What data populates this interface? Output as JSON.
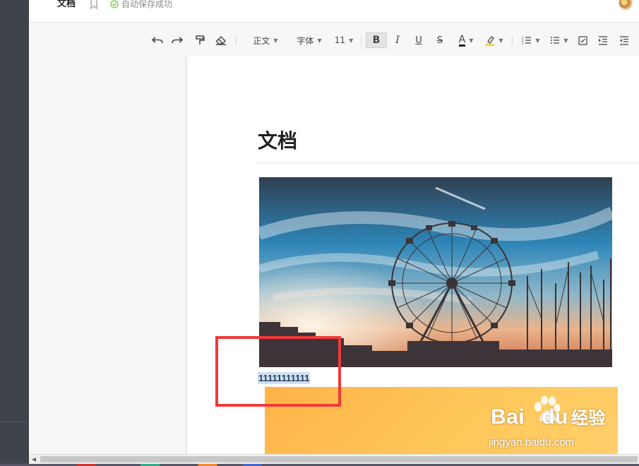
{
  "header": {
    "doc_title": "文档",
    "save_status": "自动保存成功"
  },
  "toolbar": {
    "paragraph_style": "正文",
    "font_family": "字体",
    "font_size": "11",
    "bold": "B",
    "italic": "I",
    "underline": "U",
    "strikethrough": "S",
    "font_color": "A"
  },
  "document": {
    "heading": "文档",
    "text_line": "11111111111"
  },
  "watermark": {
    "brand": "Bai",
    "brand_du": "du",
    "brand_cn": "经验",
    "url": "jingyan.baidu.com"
  },
  "colors": {
    "sidebar": "#3f444b",
    "highlight_box": "#f03a3a",
    "selection": "#cfe0f4"
  }
}
